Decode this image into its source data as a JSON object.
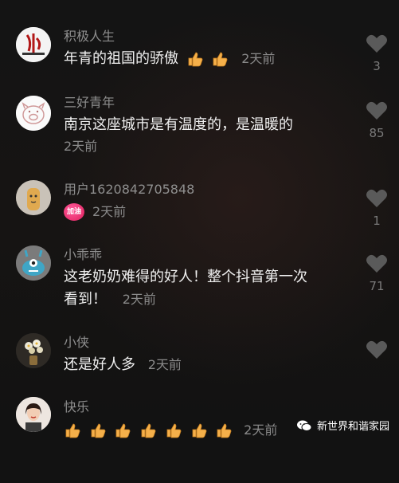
{
  "comments": [
    {
      "user": "积极人生",
      "text": "年青的祖国的骄傲",
      "emoji_count": 2,
      "time": "2天前",
      "likes": "3",
      "avatar_icon": "calligraphy-logo-icon"
    },
    {
      "user": "三好青年",
      "text": "南京这座城市是有温度的，是温暖的",
      "time": "2天前",
      "likes": "85",
      "avatar_icon": "pig-sketch-icon"
    },
    {
      "user": "用户1620842705848",
      "badge": "加油",
      "time": "2天前",
      "likes": "1",
      "avatar_icon": "cartoon-animal-icon"
    },
    {
      "user": "小乖乖",
      "text_line1": "这老奶奶难得的好人！整个抖音第一次",
      "text_line2": "看到！",
      "time": "2天前",
      "likes": "71",
      "avatar_icon": "blue-monster-icon"
    },
    {
      "user": "小侠",
      "text": "还是好人多",
      "time": "2天前",
      "avatar_icon": "flower-vase-icon"
    },
    {
      "user": "快乐",
      "emoji_count": 7,
      "time": "2天前",
      "avatar_icon": "portrait-photo-icon"
    }
  ],
  "watermark": "新世界和谐家园",
  "colors": {
    "background": "#121212",
    "username": "#8e8e8e",
    "text": "#f0f0f0",
    "heart": "#5a5a5a"
  }
}
